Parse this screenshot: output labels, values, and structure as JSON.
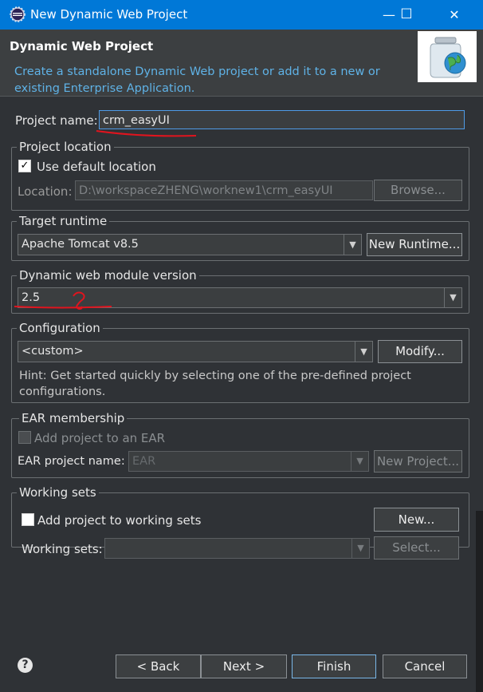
{
  "window": {
    "title": "New Dynamic Web Project",
    "minimize_glyph": "—",
    "maximize_glyph": "☐",
    "close_glyph": "✕"
  },
  "banner": {
    "title": "Dynamic Web Project",
    "description": "Create a standalone Dynamic Web project or add it to a new or existing Enterprise Application."
  },
  "project_name": {
    "label": "Project name:",
    "value": "crm_easyUI"
  },
  "project_location": {
    "group_label": "Project location",
    "use_default_label": "Use default location",
    "use_default_checked": true,
    "location_label": "Location:",
    "location_value": "D:\\workspaceZHENG\\worknew1\\crm_easyUI",
    "browse_label": "Browse..."
  },
  "target_runtime": {
    "group_label": "Target runtime",
    "value": "Apache Tomcat v8.5",
    "new_runtime_label": "New Runtime..."
  },
  "module_version": {
    "group_label": "Dynamic web module version",
    "value": "2.5"
  },
  "configuration": {
    "group_label": "Configuration",
    "value": "<custom>",
    "modify_label": "Modify...",
    "hint": "Hint: Get started quickly by selecting one of the pre-defined project configurations."
  },
  "ear": {
    "group_label": "EAR membership",
    "add_label": "Add project to an EAR",
    "name_label": "EAR project name:",
    "name_value": "EAR",
    "new_project_label": "New Project..."
  },
  "working_sets": {
    "group_label": "Working sets",
    "add_label": "Add project to working sets",
    "new_label": "New...",
    "sets_label": "Working sets:",
    "select_label": "Select..."
  },
  "footer": {
    "help_glyph": "?",
    "back_label": "< Back",
    "next_label": "Next >",
    "finish_label": "Finish",
    "cancel_label": "Cancel"
  },
  "colors": {
    "titlebar": "#0078d7",
    "background": "#2f3236",
    "banner_text": "#5fb2e6",
    "annotation": "#e0141e"
  },
  "icons": [
    "eclipse-app-icon",
    "jar-globe-icon",
    "help-icon",
    "chevron-down-icon",
    "checkmark-icon"
  ]
}
